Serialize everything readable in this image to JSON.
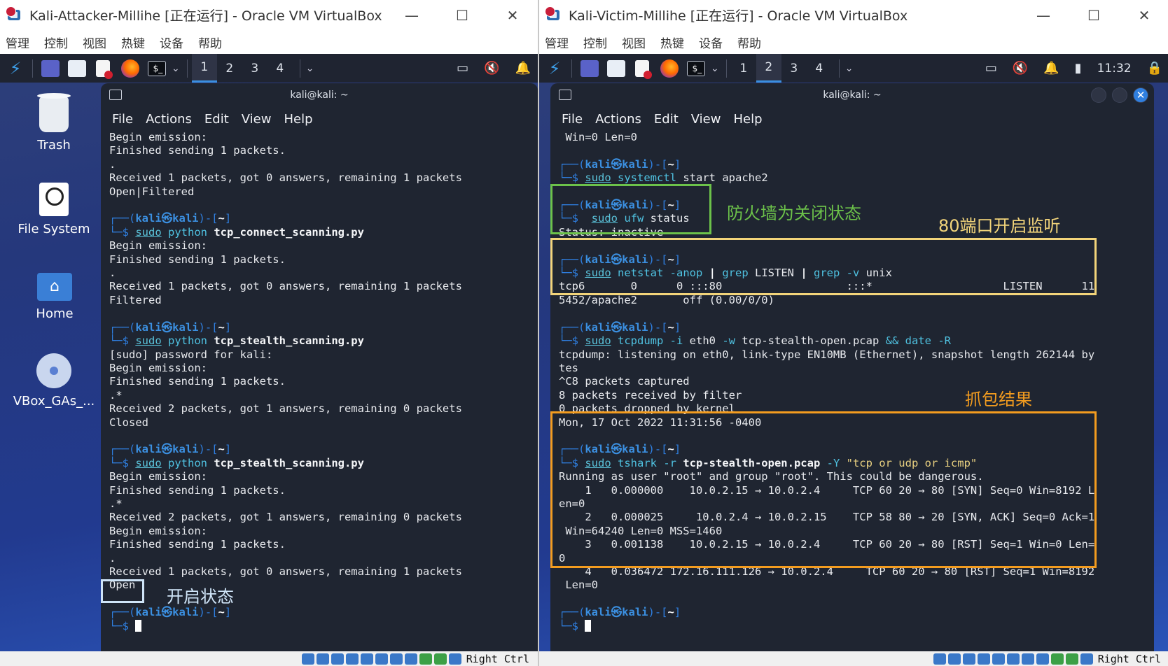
{
  "left_window": {
    "title": "Kali-Attacker-Millihe [正在运行] - Oracle VM VirtualBox",
    "menu": [
      "管理",
      "控制",
      "视图",
      "热键",
      "设备",
      "帮助"
    ],
    "workspaces": [
      "1",
      "2",
      "3",
      "4"
    ],
    "active_workspace": "1",
    "desktop_icons": [
      "Trash",
      "File System",
      "Home",
      "VBox_GAs_..."
    ],
    "terminal": {
      "title": "kali@kali: ~",
      "menu": [
        "File",
        "Actions",
        "Edit",
        "View",
        "Help"
      ],
      "lines": [
        "Begin emission:",
        "Finished sending 1 packets.",
        ".",
        "Received 1 packets, got 0 answers, remaining 1 packets",
        "Open|Filtered",
        "",
        "Begin emission:",
        "Finished sending 1 packets.",
        ".",
        "Received 1 packets, got 0 answers, remaining 1 packets",
        "Filtered",
        "",
        "[sudo] password for kali:",
        "Begin emission:",
        "Finished sending 1 packets.",
        ".*",
        "Received 2 packets, got 1 answers, remaining 0 packets",
        "Closed",
        "",
        "Begin emission:",
        "Finished sending 1 packets.",
        ".*",
        "Received 2 packets, got 1 answers, remaining 0 packets",
        "Begin emission:",
        "Finished sending 1 packets.",
        ".",
        "Received 1 packets, got 0 answers, remaining 1 packets",
        "Open"
      ],
      "prompt_user": "kali",
      "prompt_host": "kali",
      "prompt_dir": "~",
      "cmd_sudo": "sudo",
      "cmd_python": "python",
      "script_connect": "tcp_connect_scanning.py",
      "script_stealth": "tcp_stealth_scanning.py"
    },
    "annotation_open": "开启状态",
    "statusbar_text": "Right Ctrl"
  },
  "right_window": {
    "title": "Kali-Victim-Millihe [正在运行] - Oracle VM VirtualBox",
    "menu": [
      "管理",
      "控制",
      "视图",
      "热键",
      "设备",
      "帮助"
    ],
    "workspaces": [
      "1",
      "2",
      "3",
      "4"
    ],
    "active_workspace": "2",
    "clock": "11:32",
    "terminal": {
      "title": "kali@kali: ~",
      "menu": [
        "File",
        "Actions",
        "Edit",
        "View",
        "Help"
      ],
      "first_line": "Win=0 Len=0",
      "cmd1": [
        "sudo",
        "systemctl",
        " start apache2"
      ],
      "cmd2": [
        "sudo",
        "ufw",
        " status"
      ],
      "out2": "Status: inactive",
      "cmd3": [
        "sudo",
        "netstat",
        " -anop",
        " | ",
        "grep",
        " LISTEN ",
        "| ",
        "grep",
        " -v",
        " unix"
      ],
      "out3": [
        "tcp6       0      0 :::80                   :::*                    LISTEN      11",
        "5452/apache2       off (0.00/0/0)"
      ],
      "cmd4": [
        "sudo",
        "tcpdump",
        " -i",
        " eth0",
        " -w",
        " tcp-stealth-open.pcap ",
        "&&",
        " date",
        " -R"
      ],
      "out4": [
        "tcpdump: listening on eth0, link-type EN10MB (Ethernet), snapshot length 262144 by",
        "tes",
        "^C8 packets captured",
        "8 packets received by filter",
        "0 packets dropped by kernel",
        "Mon, 17 Oct 2022 11:31:56 -0400"
      ],
      "cmd5": [
        "sudo",
        "tshark",
        " -r ",
        "tcp-stealth-open.pcap",
        " -Y ",
        "\"tcp or udp or icmp\""
      ],
      "out5": [
        "Running as user \"root\" and group \"root\". This could be dangerous.",
        "    1   0.000000    10.0.2.15 → 10.0.2.4     TCP 60 20 → 80 [SYN] Seq=0 Win=8192 L",
        "en=0",
        "    2   0.000025     10.0.2.4 → 10.0.2.15    TCP 58 80 → 20 [SYN, ACK] Seq=0 Ack=1",
        " Win=64240 Len=0 MSS=1460",
        "    3   0.001138    10.0.2.15 → 10.0.2.4     TCP 60 20 → 80 [RST] Seq=1 Win=0 Len=",
        "0",
        "    4   0.036472 172.16.111.126 → 10.0.2.4     TCP 60 20 → 80 [RST] Seq=1 Win=8192",
        " Len=0"
      ]
    },
    "annotations": {
      "firewall": "防火墙为关闭状态",
      "port80": "80端口开启监听",
      "capture": "抓包结果"
    },
    "statusbar_text": "Right Ctrl"
  },
  "colors": {
    "annot_green": "#6cc24a",
    "annot_yellow": "#f2d47a",
    "annot_orange": "#f39c1f",
    "annot_white": "#cfe4f7",
    "prompt_blue": "#2f7fe0"
  },
  "icons": [
    "kali-logo-icon",
    "terminal-icon",
    "folder-icon",
    "firefox-icon",
    "bell-icon",
    "mute-icon",
    "battery-icon",
    "trash-icon",
    "home-icon",
    "cd-icon"
  ]
}
